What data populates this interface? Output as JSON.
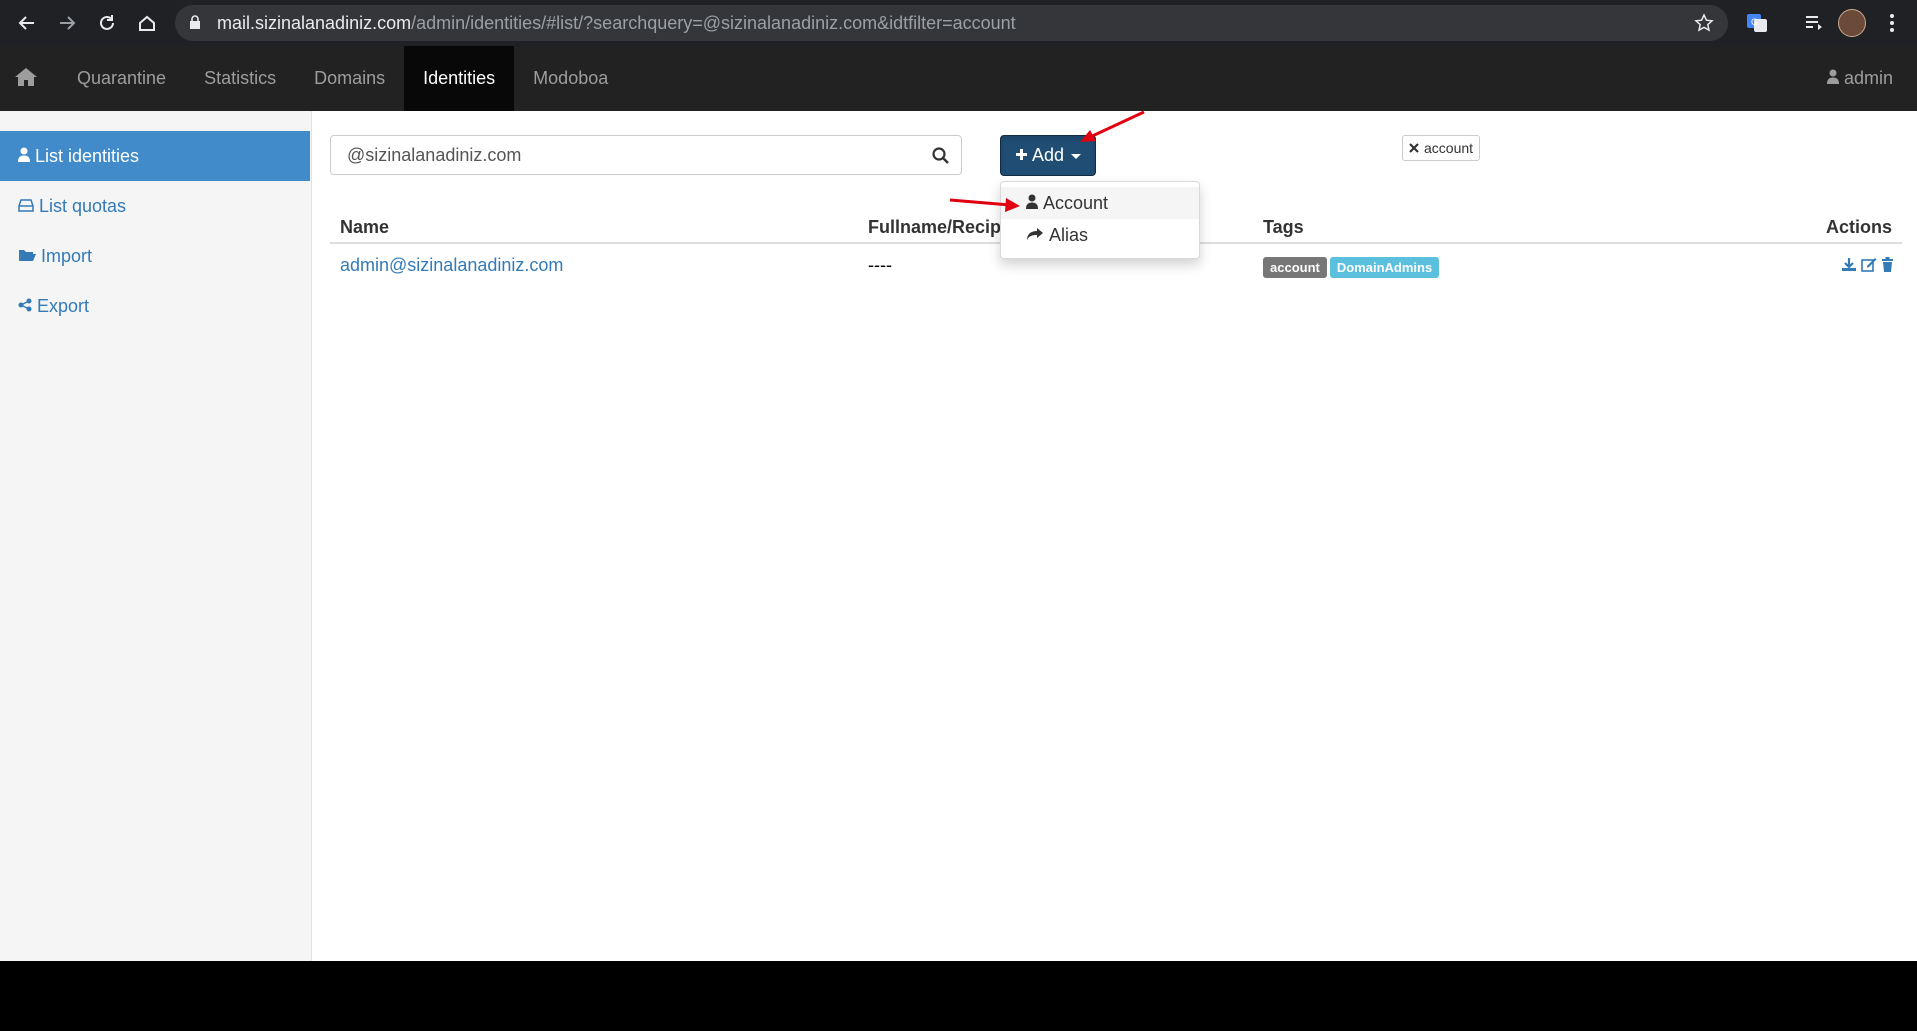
{
  "browser": {
    "url_host": "mail.sizinalanadiniz.com",
    "url_path": "/admin/identities/#list/?searchquery=@sizinalanadiniz.com&idtfilter=account"
  },
  "navbar": {
    "items": [
      {
        "label": "Quarantine"
      },
      {
        "label": "Statistics"
      },
      {
        "label": "Domains"
      },
      {
        "label": "Identities",
        "active": true
      },
      {
        "label": "Modoboa"
      }
    ],
    "user": "admin"
  },
  "sidebar": {
    "items": [
      {
        "label": "List identities",
        "icon": "user-icon",
        "active": true
      },
      {
        "label": "List quotas",
        "icon": "hdd-icon"
      },
      {
        "label": "Import",
        "icon": "folder-open-icon"
      },
      {
        "label": "Export",
        "icon": "share-icon"
      }
    ]
  },
  "search": {
    "value": "@sizinalanadiniz.com"
  },
  "add_button": {
    "label": "Add"
  },
  "add_menu": {
    "items": [
      {
        "label": "Account",
        "icon": "user-icon"
      },
      {
        "label": "Alias",
        "icon": "share-arrow-icon"
      }
    ]
  },
  "filter": {
    "label": "account"
  },
  "table": {
    "headers": [
      "Name",
      "Fullname/Recipi",
      "Tags",
      "Actions"
    ],
    "rows": [
      {
        "name": "admin@sizinalanadiniz.com",
        "fullname": "----",
        "tags": [
          {
            "label": "account",
            "color": "#777777"
          },
          {
            "label": "DomainAdmins",
            "color": "#5bc0de"
          }
        ]
      }
    ]
  },
  "colors": {
    "navbar_bg": "#222222",
    "active_nav": "#080808",
    "sidebar_active": "#428bca",
    "link": "#337ab7",
    "add_button": "#204d74",
    "annotation_arrow": "#e0000f"
  }
}
